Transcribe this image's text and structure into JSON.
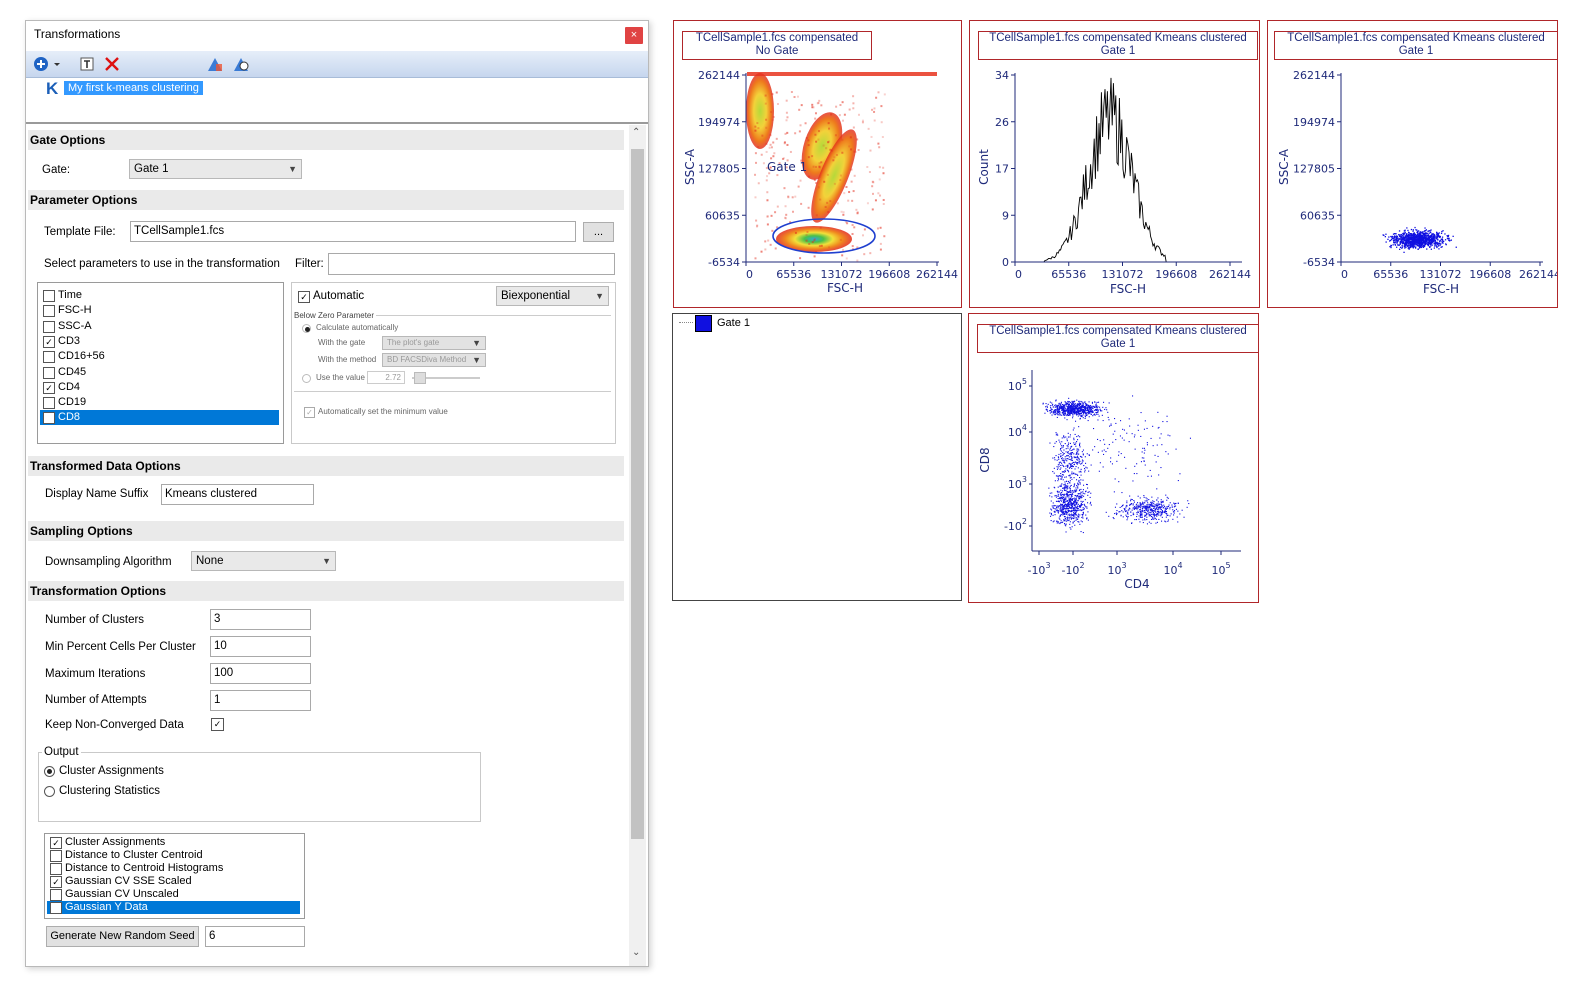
{
  "window": {
    "title": "Transformations",
    "close_glyph": "×"
  },
  "toolbar": {
    "icons": [
      "add-icon",
      "dropdown-arrow-icon",
      "text-format-icon",
      "delete-icon",
      "chart-export-icon",
      "chart-preview-icon"
    ]
  },
  "tree": {
    "badge": "K",
    "item_label": "My first k-means clustering"
  },
  "gate_options": {
    "header": "Gate Options",
    "gate_label": "Gate:",
    "gate_value": "Gate 1"
  },
  "parameter_options": {
    "header": "Parameter Options",
    "template_label": "Template File:",
    "template_value": "TCellSample1.fcs",
    "browse_label": "...",
    "select_label": "Select parameters to use in the transformation",
    "filter_label": "Filter:",
    "filter_value": "",
    "parameters": [
      {
        "name": "Time",
        "checked": false,
        "selected": false
      },
      {
        "name": "FSC-H",
        "checked": false,
        "selected": false
      },
      {
        "name": "SSC-A",
        "checked": false,
        "selected": false
      },
      {
        "name": "CD3",
        "checked": true,
        "selected": false
      },
      {
        "name": "CD16+56",
        "checked": false,
        "selected": false
      },
      {
        "name": "CD45",
        "checked": false,
        "selected": false
      },
      {
        "name": "CD4",
        "checked": true,
        "selected": false
      },
      {
        "name": "CD19",
        "checked": false,
        "selected": false
      },
      {
        "name": "CD8",
        "checked": true,
        "selected": true
      }
    ],
    "automatic_label": "Automatic",
    "scale_value": "Biexponential",
    "below_zero_title": "Below Zero Parameter",
    "calc_auto_label": "Calculate automatically",
    "with_gate_label": "With the gate",
    "with_gate_value": "The plot's gate",
    "with_method_label": "With the method",
    "with_method_value": "BD FACSDiva Method",
    "use_value_label": "Use the value",
    "use_value_value": "2.72",
    "auto_min_label": "Automatically set the minimum value"
  },
  "transformed_data": {
    "header": "Transformed Data Options",
    "suffix_label": "Display Name Suffix",
    "suffix_value": "Kmeans clustered"
  },
  "sampling": {
    "header": "Sampling Options",
    "algo_label": "Downsampling Algorithm",
    "algo_value": "None"
  },
  "transformation": {
    "header": "Transformation Options",
    "clusters_label": "Number of Clusters",
    "clusters_value": "3",
    "min_pct_label": "Min Percent Cells Per Cluster",
    "min_pct_value": "10",
    "max_iter_label": "Maximum Iterations",
    "max_iter_value": "100",
    "attempts_label": "Number of Attempts",
    "attempts_value": "1",
    "keep_label": "Keep Non-Converged Data",
    "output_label": "Output",
    "radio_assign": "Cluster Assignments",
    "radio_stats": "Clustering Statistics",
    "outputs": [
      {
        "name": "Cluster Assignments",
        "checked": true,
        "selected": false
      },
      {
        "name": "Distance to Cluster Centroid",
        "checked": false,
        "selected": false
      },
      {
        "name": "Distance to Centroid Histograms",
        "checked": false,
        "selected": false
      },
      {
        "name": "Gaussian CV SSE Scaled",
        "checked": true,
        "selected": false
      },
      {
        "name": "Gaussian CV Unscaled",
        "checked": false,
        "selected": false
      },
      {
        "name": "Gaussian Y Data",
        "checked": true,
        "selected": true
      }
    ],
    "seed_button": "Generate New Random Seed",
    "seed_value": "6"
  },
  "plots": {
    "p1": {
      "title1": "TCellSample1.fcs compensated",
      "title2": "No Gate",
      "ylabel": "SSC-A",
      "xlabel": "FSC-H",
      "gate_label": "Gate 1",
      "yticks": [
        "262144",
        "194974",
        "127805",
        "60635",
        "-6534"
      ],
      "xticks": [
        "0",
        "65536",
        "131072",
        "196608",
        "262144"
      ]
    },
    "p2": {
      "title1": "TCellSample1.fcs compensated Kmeans clustered",
      "title2": "Gate 1",
      "ylabel": "Count",
      "xlabel": "FSC-H",
      "yticks": [
        "34",
        "26",
        "17",
        "9",
        "0"
      ],
      "xticks": [
        "0",
        "65536",
        "131072",
        "196608",
        "262144"
      ]
    },
    "p3": {
      "title1": "TCellSample1.fcs compensated Kmeans clustered",
      "title2": "Gate 1",
      "ylabel": "SSC-A",
      "xlabel": "FSC-H",
      "yticks": [
        "262144",
        "194974",
        "127805",
        "60635",
        "-6534"
      ],
      "xticks": [
        "0",
        "65536",
        "131072",
        "196608",
        "262144"
      ]
    },
    "legend": {
      "item": "Gate 1",
      "color": "#1010e0"
    },
    "p5": {
      "title1": "TCellSample1.fcs compensated Kmeans clustered",
      "title2": "Gate 1",
      "ylabel": "CD8",
      "xlabel": "CD4",
      "ytick_base": [
        "10",
        "10",
        "10",
        "-10"
      ],
      "ytick_exp": [
        "5",
        "4",
        "3",
        "2"
      ],
      "xtick_base": [
        "-10",
        "-10",
        "10",
        "10",
        "10"
      ],
      "xtick_exp": [
        "3",
        "2",
        "3",
        "4",
        "5"
      ]
    }
  },
  "colors": {
    "accent": "#3399ff",
    "selection": "#0078d7",
    "plot_border": "#b0262a",
    "plot_text": "#1f2a7a",
    "dots": "#1010e0"
  }
}
